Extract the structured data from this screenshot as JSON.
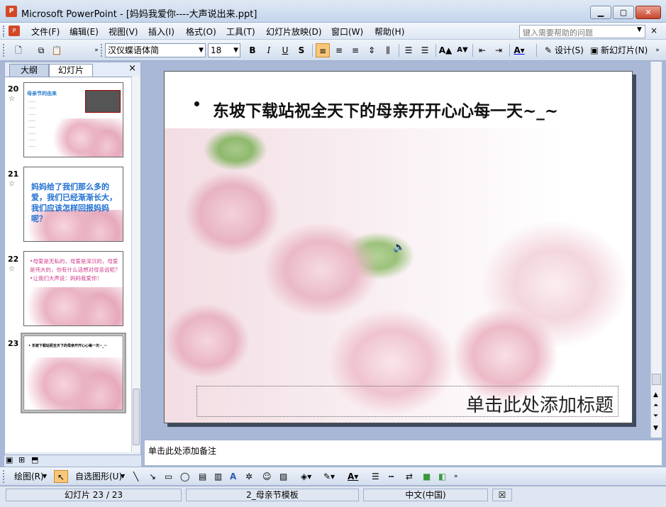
{
  "window": {
    "title": "Microsoft PowerPoint - [妈妈我爱你----大声说出来.ppt]",
    "min": "▁",
    "max": "▢",
    "close": "✕",
    "doc_min": "_",
    "doc_restore": "▫",
    "doc_close": "×"
  },
  "menu": {
    "items": [
      "文件(F)",
      "编辑(E)",
      "视图(V)",
      "插入(I)",
      "格式(O)",
      "工具(T)",
      "幻灯片放映(D)",
      "窗口(W)",
      "帮助(H)"
    ],
    "help_placeholder": "键入需要帮助的问题"
  },
  "toolbar": {
    "font": "汉仪蝶语体简",
    "size": "18",
    "bold": "B",
    "italic": "I",
    "underline": "U",
    "shadow": "S",
    "design": "设计(S)",
    "new_slide": "新幻灯片(N)"
  },
  "pane": {
    "tab_outline": "大纲",
    "tab_slides": "幻灯片",
    "close": "×"
  },
  "thumbnails": [
    {
      "num": "20",
      "star": "☆",
      "title": "母亲节的由来",
      "lines": [
        "……",
        "……",
        "……",
        "……",
        "……",
        "……",
        "……",
        "……"
      ]
    },
    {
      "num": "21",
      "star": "☆",
      "text": "妈妈给了我们那么多的爱，我们已经渐渐长大，我们应该怎样回报妈妈呢？"
    },
    {
      "num": "22",
      "star": "☆",
      "text": "•母爱是无私的，母爱是深沉的，母爱是伟大的，你有什么话想对母亲说呢？\n•让我们大声说：妈妈我爱你！"
    },
    {
      "num": "23",
      "star": "",
      "text": "• 东坡下载站祝全天下的母亲开开心心每一天~_~"
    }
  ],
  "slide": {
    "bullet_text": "东坡下载站祝全天下的母亲开开心心每一天~_~",
    "title_placeholder": "单击此处添加标题",
    "speaker_icon": "🔈"
  },
  "notes": {
    "placeholder": "单击此处添加备注"
  },
  "drawbar": {
    "draw": "绘图(R)",
    "autoshape": "自选图形(U)"
  },
  "status": {
    "slide": "幻灯片 23 / 23",
    "template": "2_母亲节模板",
    "language": "中文(中国)"
  }
}
